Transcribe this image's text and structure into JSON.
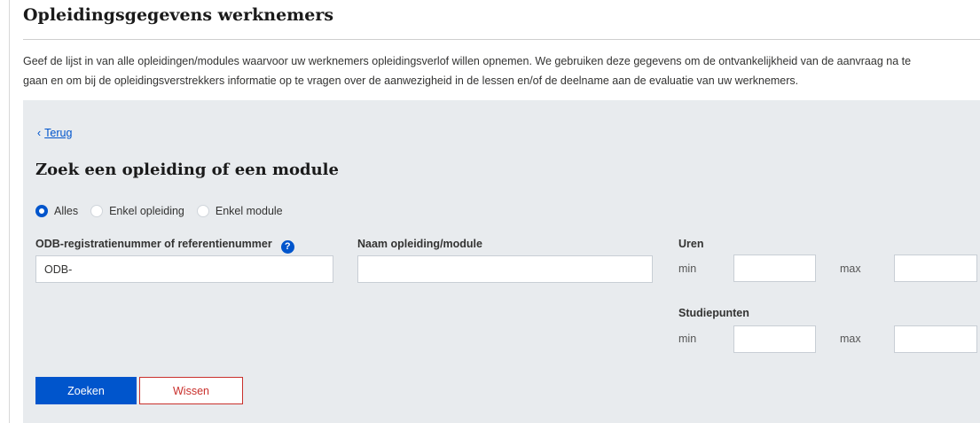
{
  "page": {
    "title": "Opleidingsgegevens werknemers",
    "intro_line1": "Geef de lijst in van alle opleidingen/modules waarvoor uw werknemers opleidingsverlof willen opnemen. We gebruiken deze gegevens om de ontvankelijkheid van de aanvraag na te",
    "intro_line2": "gaan en om bij de opleidingsverstrekkers informatie op te vragen over de aanwezigheid in de lessen en/of de deelname aan de evaluatie van uw werknemers."
  },
  "search_panel": {
    "back_chevron": "‹",
    "back_label": "Terug",
    "title": "Zoek een opleiding of een module",
    "radio_options": [
      {
        "label": "Alles",
        "checked": true
      },
      {
        "label": "Enkel opleiding",
        "checked": false
      },
      {
        "label": "Enkel module",
        "checked": false
      }
    ],
    "odb_field": {
      "label": "ODB-registratienummer of referentienummer",
      "help_icon": "?",
      "value": "ODB-"
    },
    "name_field": {
      "label": "Naam opleiding/module",
      "value": ""
    },
    "hours": {
      "label": "Uren",
      "min_label": "min",
      "max_label": "max",
      "min_value": "",
      "max_value": ""
    },
    "study_points": {
      "label": "Studiepunten",
      "min_label": "min",
      "max_label": "max",
      "min_value": "",
      "max_value": ""
    },
    "search_button": "Zoeken",
    "clear_button": "Wissen"
  },
  "icons": {
    "back": "chevron-left-icon",
    "help": "question-circle-icon"
  },
  "colors": {
    "primary": "#0055cc",
    "danger": "#c9302c",
    "panel_bg": "#e8ebee"
  }
}
